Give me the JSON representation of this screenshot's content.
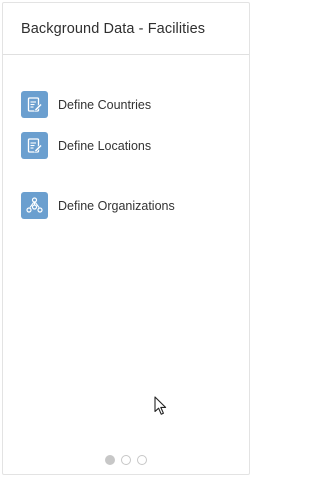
{
  "card": {
    "title": "Background Data - Facilities"
  },
  "items": [
    {
      "label": "Define Countries",
      "icon": "edit-document-icon"
    },
    {
      "label": "Define Locations",
      "icon": "edit-document-icon"
    },
    {
      "label": "Define Organizations",
      "icon": "org-chart-icon"
    }
  ],
  "pager": {
    "pages": 3,
    "active_page": 1
  },
  "colors": {
    "icon_bg": "#6b9fcf",
    "title_text": "#2f2f2f",
    "dot": "#c7c7c7"
  }
}
